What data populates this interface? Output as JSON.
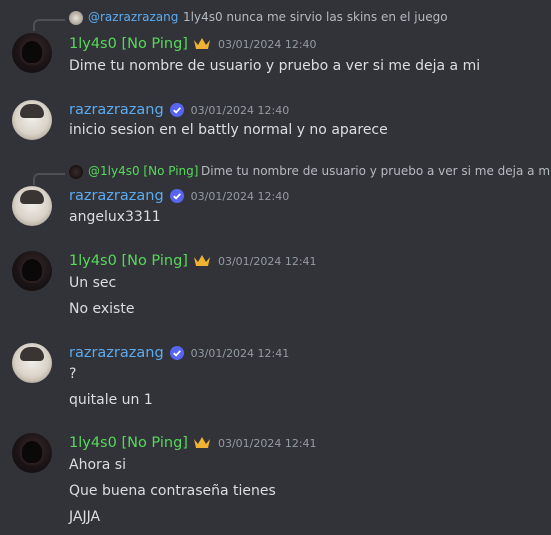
{
  "colors": {
    "background": "#313338",
    "name_green": "#57d95a",
    "name_blue": "#5dabf0",
    "timestamp": "#949ba4",
    "text": "#dbdee1",
    "crown": "#f0b232",
    "verified": "#5865f2"
  },
  "messages": [
    {
      "reply": {
        "author": "@razrazrazang",
        "text": "1ly4s0 nunca me sirvio las skins en el juego"
      },
      "author": "1ly4s0 [No Ping]",
      "badge": "crown-icon",
      "timestamp": "03/01/2024 12:40",
      "lines": [
        "Dime tu nombre de usuario y pruebo a ver si me deja a mi"
      ]
    },
    {
      "author": "razrazrazang",
      "badge": "verified-icon",
      "timestamp": "03/01/2024 12:40",
      "lines": [
        "inicio sesion en el battly normal y no aparece"
      ]
    },
    {
      "reply": {
        "author": "@1ly4s0 [No Ping]",
        "text": "Dime tu nombre de usuario y pruebo a ver si me deja a mi"
      },
      "author": "razrazrazang",
      "badge": "verified-icon",
      "timestamp": "03/01/2024 12:40",
      "lines": [
        "angelux3311"
      ]
    },
    {
      "author": "1ly4s0 [No Ping]",
      "badge": "crown-icon",
      "timestamp": "03/01/2024 12:41",
      "lines": [
        "Un sec",
        "No existe"
      ]
    },
    {
      "author": "razrazrazang",
      "badge": "verified-icon",
      "timestamp": "03/01/2024 12:41",
      "lines": [
        "?",
        "quitale un 1"
      ]
    },
    {
      "author": "1ly4s0 [No Ping]",
      "badge": "crown-icon",
      "timestamp": "03/01/2024 12:41",
      "lines": [
        "Ahora si",
        "Que buena contraseña tienes",
        "JAJJA"
      ]
    }
  ]
}
